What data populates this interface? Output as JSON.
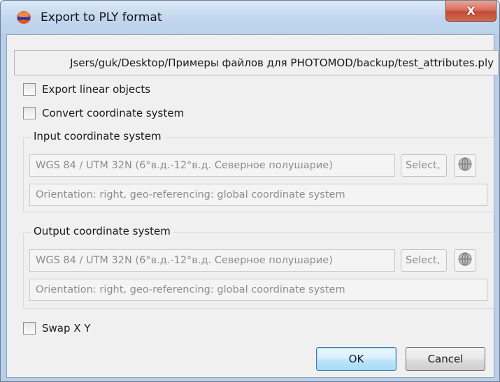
{
  "window": {
    "title": "Export to PLY format",
    "close_label": "X"
  },
  "file_path": "Jsers/guk/Desktop/Примеры файлов для PHOTOMOD/backup/test_attributes.ply",
  "options": {
    "export_linear": {
      "label": "Export linear objects",
      "checked": false
    },
    "convert_cs": {
      "label": "Convert coordinate system",
      "checked": false
    },
    "swap_xy": {
      "label": "Swap X Y",
      "checked": false
    }
  },
  "input_cs": {
    "legend": "Input coordinate system",
    "system": "WGS 84 / UTM 32N (6°в.д.-12°в.д. Северное полушарие)",
    "select_label": "Select,",
    "orientation": "Orientation: right, geo-referencing: global coordinate system"
  },
  "output_cs": {
    "legend": "Output coordinate system",
    "system": "WGS 84 / UTM 32N (6°в.д.-12°в.д. Северное полушарие)",
    "select_label": "Select,",
    "orientation": "Orientation: right, geo-referencing: global coordinate system"
  },
  "buttons": {
    "ok": "OK",
    "cancel": "Cancel"
  },
  "icons": {
    "app": "3d-glasses-icon",
    "globe": "globe-icon"
  }
}
